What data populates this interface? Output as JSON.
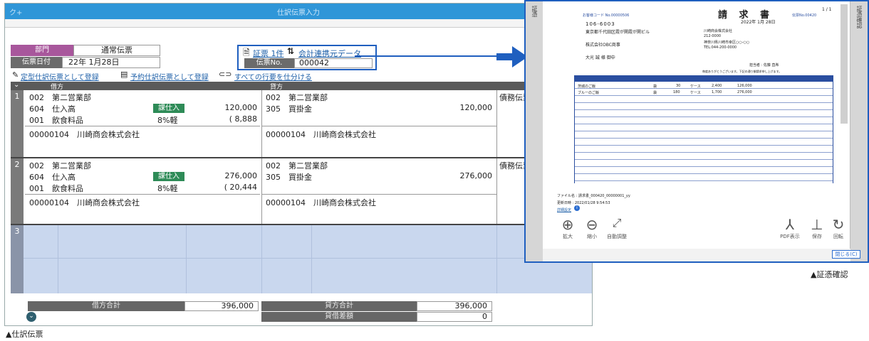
{
  "app": {
    "logo": "ク+",
    "title": "仕訳伝票入力",
    "ledger_label": "部門",
    "slip_type": "通常伝票",
    "date_label": "伝票日付",
    "date_value": "22年 1月28日",
    "voucher_link": "証票 1件",
    "accounting_link": "会計連携元データ",
    "slip_no_label": "伝票No.",
    "slip_no_value": "000042",
    "action_register_regular": "定型仕訳伝票として登録",
    "action_register_scheduled": "予約仕訳伝票として登録",
    "action_expand_all": "すべての行要を仕分ける",
    "col_debit": "借方",
    "col_credit": "貸方",
    "entries": [
      {
        "num": "1",
        "debit_dept_code": "002",
        "debit_dept": "第二営業部",
        "debit_acct_code": "604",
        "debit_acct": "仕入高",
        "debit_badge": "課仕入",
        "debit_amount": "120,000",
        "debit_sub_code": "001",
        "debit_sub": "飲食料品",
        "tax_rate": "8%軽",
        "tax_amount": "( 8,888",
        "debit_partner_code": "00000104",
        "debit_partner": "川崎商会株式会社",
        "credit_dept_code": "002",
        "credit_dept": "第二営業部",
        "credit_acct_code": "305",
        "credit_acct": "買掛金",
        "credit_amount": "120,000",
        "credit_partner_code": "00000104",
        "credit_partner": "川崎商会株式会社",
        "note": "債務伝票"
      },
      {
        "num": "2",
        "debit_dept_code": "002",
        "debit_dept": "第二営業部",
        "debit_acct_code": "604",
        "debit_acct": "仕入高",
        "debit_badge": "課仕入",
        "debit_amount": "276,000",
        "debit_sub_code": "001",
        "debit_sub": "飲食料品",
        "tax_rate": "8%軽",
        "tax_amount": "( 20,444",
        "debit_partner_code": "00000104",
        "debit_partner": "川崎商会株式会社",
        "credit_dept_code": "002",
        "credit_dept": "第二営業部",
        "credit_acct_code": "305",
        "credit_acct": "買掛金",
        "credit_amount": "276,000",
        "credit_partner_code": "00000104",
        "credit_partner": "川崎商会株式会社",
        "note": "債務伝票"
      }
    ],
    "empty_row_num": "3",
    "debit_total_label": "借方合計",
    "debit_total": "396,000",
    "credit_total_label": "貸方合計",
    "credit_total": "396,000",
    "diff_label": "貸借差額",
    "diff_value": "0"
  },
  "doc": {
    "side_label_left": "証憑",
    "side_label_right": "証憑確認",
    "title": "請 求 書",
    "page": "1 / 1",
    "date": "2022年 1月 28日",
    "customer_code": "お客様コード No.00000506",
    "invoice_no": "伝票No.00420",
    "postal": "106-6003",
    "addr1": "東京都千代田区霞が関霞が関ビル",
    "company_to": "株式会社OBC商事",
    "greeting": "大光 誠 様 御中",
    "from_company": "川崎商会株式会社",
    "from_postal": "212-0000",
    "from_addr": "神奈川県川崎市幸区○○-○○",
    "from_tel": "TEL:044-200-0000",
    "staff": "担当者 : 佐藤 直希",
    "thanks": "毎度ありがとうございます。下記の通り御請求申し上げます。",
    "items": [
      {
        "name": "茨城のご飯",
        "unit": "袋",
        "qty": "30",
        "per": "ケース",
        "price": "2,400",
        "amount": "126,000"
      },
      {
        "name": "ブルーのご飯",
        "unit": "袋",
        "qty": "180",
        "per": "ケース",
        "price": "1,700",
        "amount": "276,000"
      }
    ],
    "file_name": "ファイル名 : 請求書_000420_00000001_yy",
    "updated": "更新日時 : 2022/01/28 9:54:53",
    "detail_link": "詳細設定",
    "tools": [
      {
        "icon": "⊕",
        "label": "拡大"
      },
      {
        "icon": "⊖",
        "label": "縮小"
      },
      {
        "icon": "⤢",
        "label": "自動調整"
      },
      {
        "icon": "⅄",
        "label": "PDF表示"
      },
      {
        "icon": "⊥",
        "label": "保存"
      },
      {
        "icon": "↻",
        "label": "回転"
      }
    ],
    "close_button": "閉じる(C)"
  },
  "captions": {
    "left": "▲仕訳伝票",
    "right": "▲証憑確認"
  },
  "colors": {
    "titlebar": "#2f96d8",
    "magenta": "#a8579c",
    "green_badge": "#2e8b57",
    "arrow": "#1f5fbf",
    "empty_row": "#c9d7ee"
  }
}
